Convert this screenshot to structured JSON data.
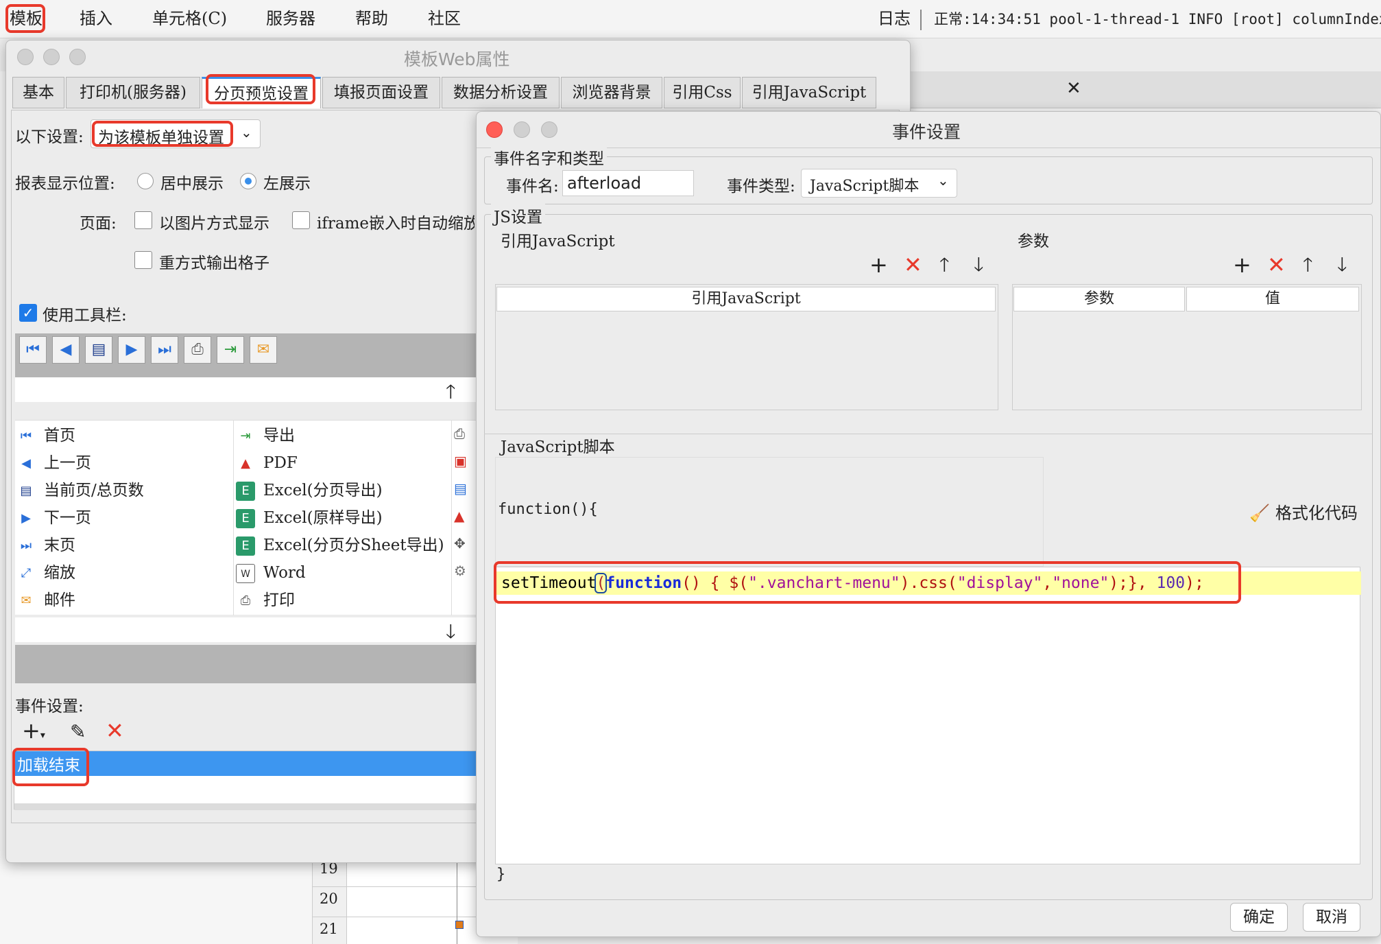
{
  "menubar": {
    "items": [
      "模板",
      "插入",
      "单元格(C)",
      "服务器",
      "帮助",
      "社区"
    ],
    "log_label": "日志",
    "log_text": "正常:14:34:51 pool-1-thread-1 INFO [root] columnIndex:1"
  },
  "row_numbers": [
    "19",
    "20",
    "21"
  ],
  "web_dialog": {
    "title": "模板Web属性",
    "tabs": [
      "基本",
      "打印机(服务器)",
      "分页预览设置",
      "填报页面设置",
      "数据分析设置",
      "浏览器背景",
      "引用Css",
      "引用JavaScript"
    ],
    "setting_label": "以下设置:",
    "setting_value": "为该模板单独设置",
    "position_label": "报表显示位置:",
    "position_options": [
      "居中展示",
      "左展示"
    ],
    "page_label": "页面:",
    "page_options": [
      "以图片方式显示",
      "iframe嵌入时自动缩放",
      "重方式输出格子"
    ],
    "toolbar_label": "使用工具栏:",
    "toolbar_items_col1": [
      "首页",
      "上一页",
      "当前页/总页数",
      "下一页",
      "末页",
      "缩放",
      "邮件"
    ],
    "toolbar_items_col2": [
      "导出",
      "PDF",
      "Excel(分页导出)",
      "Excel(原样导出)",
      "Excel(分页分Sheet导出)",
      "Word",
      "打印"
    ],
    "event_label": "事件设置:",
    "event_item": "加载结束"
  },
  "event_dialog": {
    "title": "事件设置",
    "name_group": "事件名字和类型",
    "name_label": "事件名:",
    "name_value": "afterload",
    "type_label": "事件类型:",
    "type_value": "JavaScript脚本",
    "js_group": "JS设置",
    "ref_js_label": "引用JavaScript",
    "params_label": "参数",
    "ref_js_header": "引用JavaScript",
    "param_header": "参数",
    "value_header": "值",
    "script_label": "JavaScript脚本",
    "func_open": "function(){",
    "format_label": "格式化代码",
    "code_line": {
      "p1": "setTimeout",
      "p2": "(",
      "p3": "function",
      "p4": "() { $(",
      "p5": "\".vanchart-menu\"",
      "p6": ").css(",
      "p7": "\"display\"",
      "p8": ",",
      "p9": "\"none\"",
      "p10": ");}, ",
      "p11": "100",
      "p12": ");"
    },
    "func_close": "}",
    "ok": "确定",
    "cancel": "取消"
  }
}
